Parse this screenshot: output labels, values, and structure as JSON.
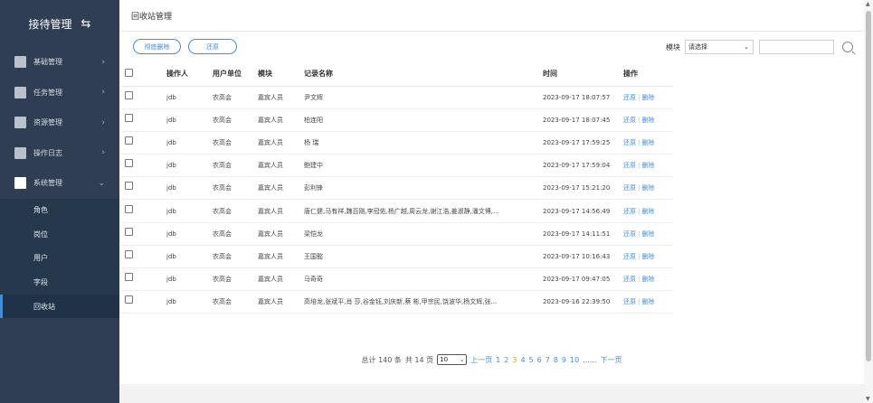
{
  "sidebar": {
    "title": "接待管理",
    "swap_icon": "⇆",
    "menu": [
      {
        "label": "基础管理"
      },
      {
        "label": "任务管理"
      },
      {
        "label": "资源管理"
      },
      {
        "label": "操作日志"
      },
      {
        "label": "系统管理"
      }
    ],
    "submenu": [
      {
        "label": "角色"
      },
      {
        "label": "岗位"
      },
      {
        "label": "用户"
      },
      {
        "label": "字段"
      },
      {
        "label": "回收站"
      }
    ]
  },
  "page": {
    "title": "回收站管理",
    "purge_label": "彻底删除",
    "restore_label": "还原",
    "module_label": "模块",
    "module_select": "请选择",
    "search_placeholder": ""
  },
  "table": {
    "headers": [
      "操作人",
      "用户单位",
      "模块",
      "记录名称",
      "时间",
      "操作"
    ],
    "restore_action": "还原",
    "delete_action": "删除",
    "rows": [
      [
        "jdb",
        "农高会",
        "嘉宾人员",
        "尹文辉",
        "2023-09-17 18:07:57"
      ],
      [
        "jdb",
        "农高会",
        "嘉宾人员",
        "柏连阳",
        "2023-09-17 18:07:45"
      ],
      [
        "jdb",
        "农高会",
        "嘉宾人员",
        "杨 瑞",
        "2023-09-17 17:59:25"
      ],
      [
        "jdb",
        "农高会",
        "嘉宾人员",
        "鲍建中",
        "2023-09-17 17:59:04"
      ],
      [
        "jdb",
        "农高会",
        "嘉宾人员",
        "彭利锋",
        "2023-09-17 15:21:20"
      ],
      [
        "jdb",
        "农高会",
        "嘉宾人员",
        "唐仁健,马有祥,魏百刚,李冠佑,杨广越,周云龙,谢江浩,姜淑静,潘文博,...",
        "2023-09-17 14:56:49"
      ],
      [
        "jdb",
        "农高会",
        "嘉宾人员",
        "梁恺龙",
        "2023-09-17 14:11:51"
      ],
      [
        "jdb",
        "农高会",
        "嘉宾人员",
        "王国懿",
        "2023-09-17 10:16:43"
      ],
      [
        "jdb",
        "农高会",
        "嘉宾人员",
        "马奇奇",
        "2023-09-17 09:47:05"
      ],
      [
        "jdb",
        "农高会",
        "嘉宾人员",
        "高培龙,张斌平,肖 莎,谷金钰,刘庆新,蔡 彬,甲宗民,饶波华,杨文辉,张...",
        "2023-09-16 22:39:50"
      ]
    ]
  },
  "pager": {
    "total": "总计 140 条",
    "pages_text": "共 14 页",
    "page_size": "10",
    "prev": "上一页",
    "pages": [
      "1",
      "2",
      "3",
      "4",
      "5",
      "6",
      "7",
      "8",
      "9",
      "10"
    ],
    "current": "3",
    "ellipsis": "......",
    "next": "下一页"
  }
}
